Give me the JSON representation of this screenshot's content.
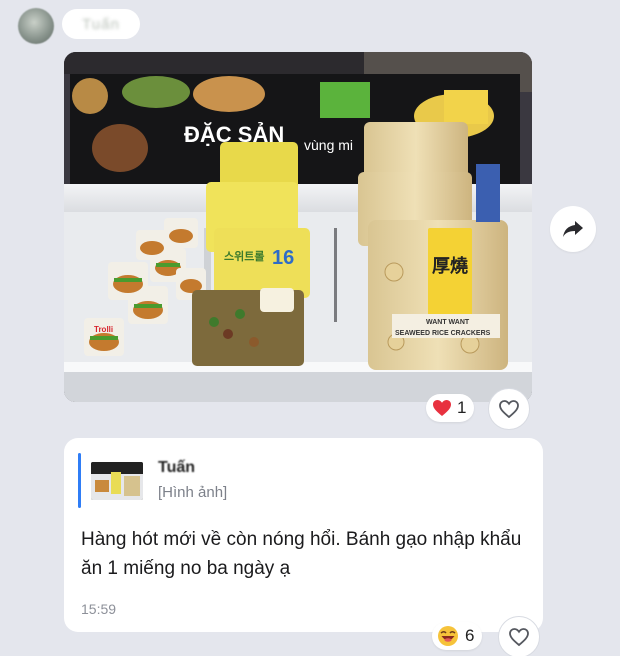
{
  "sender": {
    "name": "Tuấn",
    "avatar_icon": "avatar-blurred"
  },
  "photo": {
    "sign_text": "ĐẶC SẢN",
    "sign_subtext": "vùng mi",
    "snack_label": "스위트롤",
    "snack_number": "16",
    "cracker_brand": "WANT WANT",
    "cracker_name": "SEAWEED RICE CRACKERS",
    "cracker_chinese": "厚燒",
    "burger_candy_label": "Trolli"
  },
  "photo_reaction": {
    "icon": "heart-icon",
    "count": "1"
  },
  "share_icon": "share-arrow-icon",
  "message": {
    "quote_author": "Tuấn",
    "quote_caption": "[Hình ảnh]",
    "text": "Hàng hót mới về còn nóng hổi. Bánh gạo nhập khẩu ăn 1 miếng no ba ngày ạ",
    "time": "15:59"
  },
  "message_reaction": {
    "icon": "laughing-emoji-icon",
    "count": "6"
  },
  "colors": {
    "background": "#e4e6ed",
    "quote_bar": "#2f7df6",
    "heart": "#e8313f"
  }
}
